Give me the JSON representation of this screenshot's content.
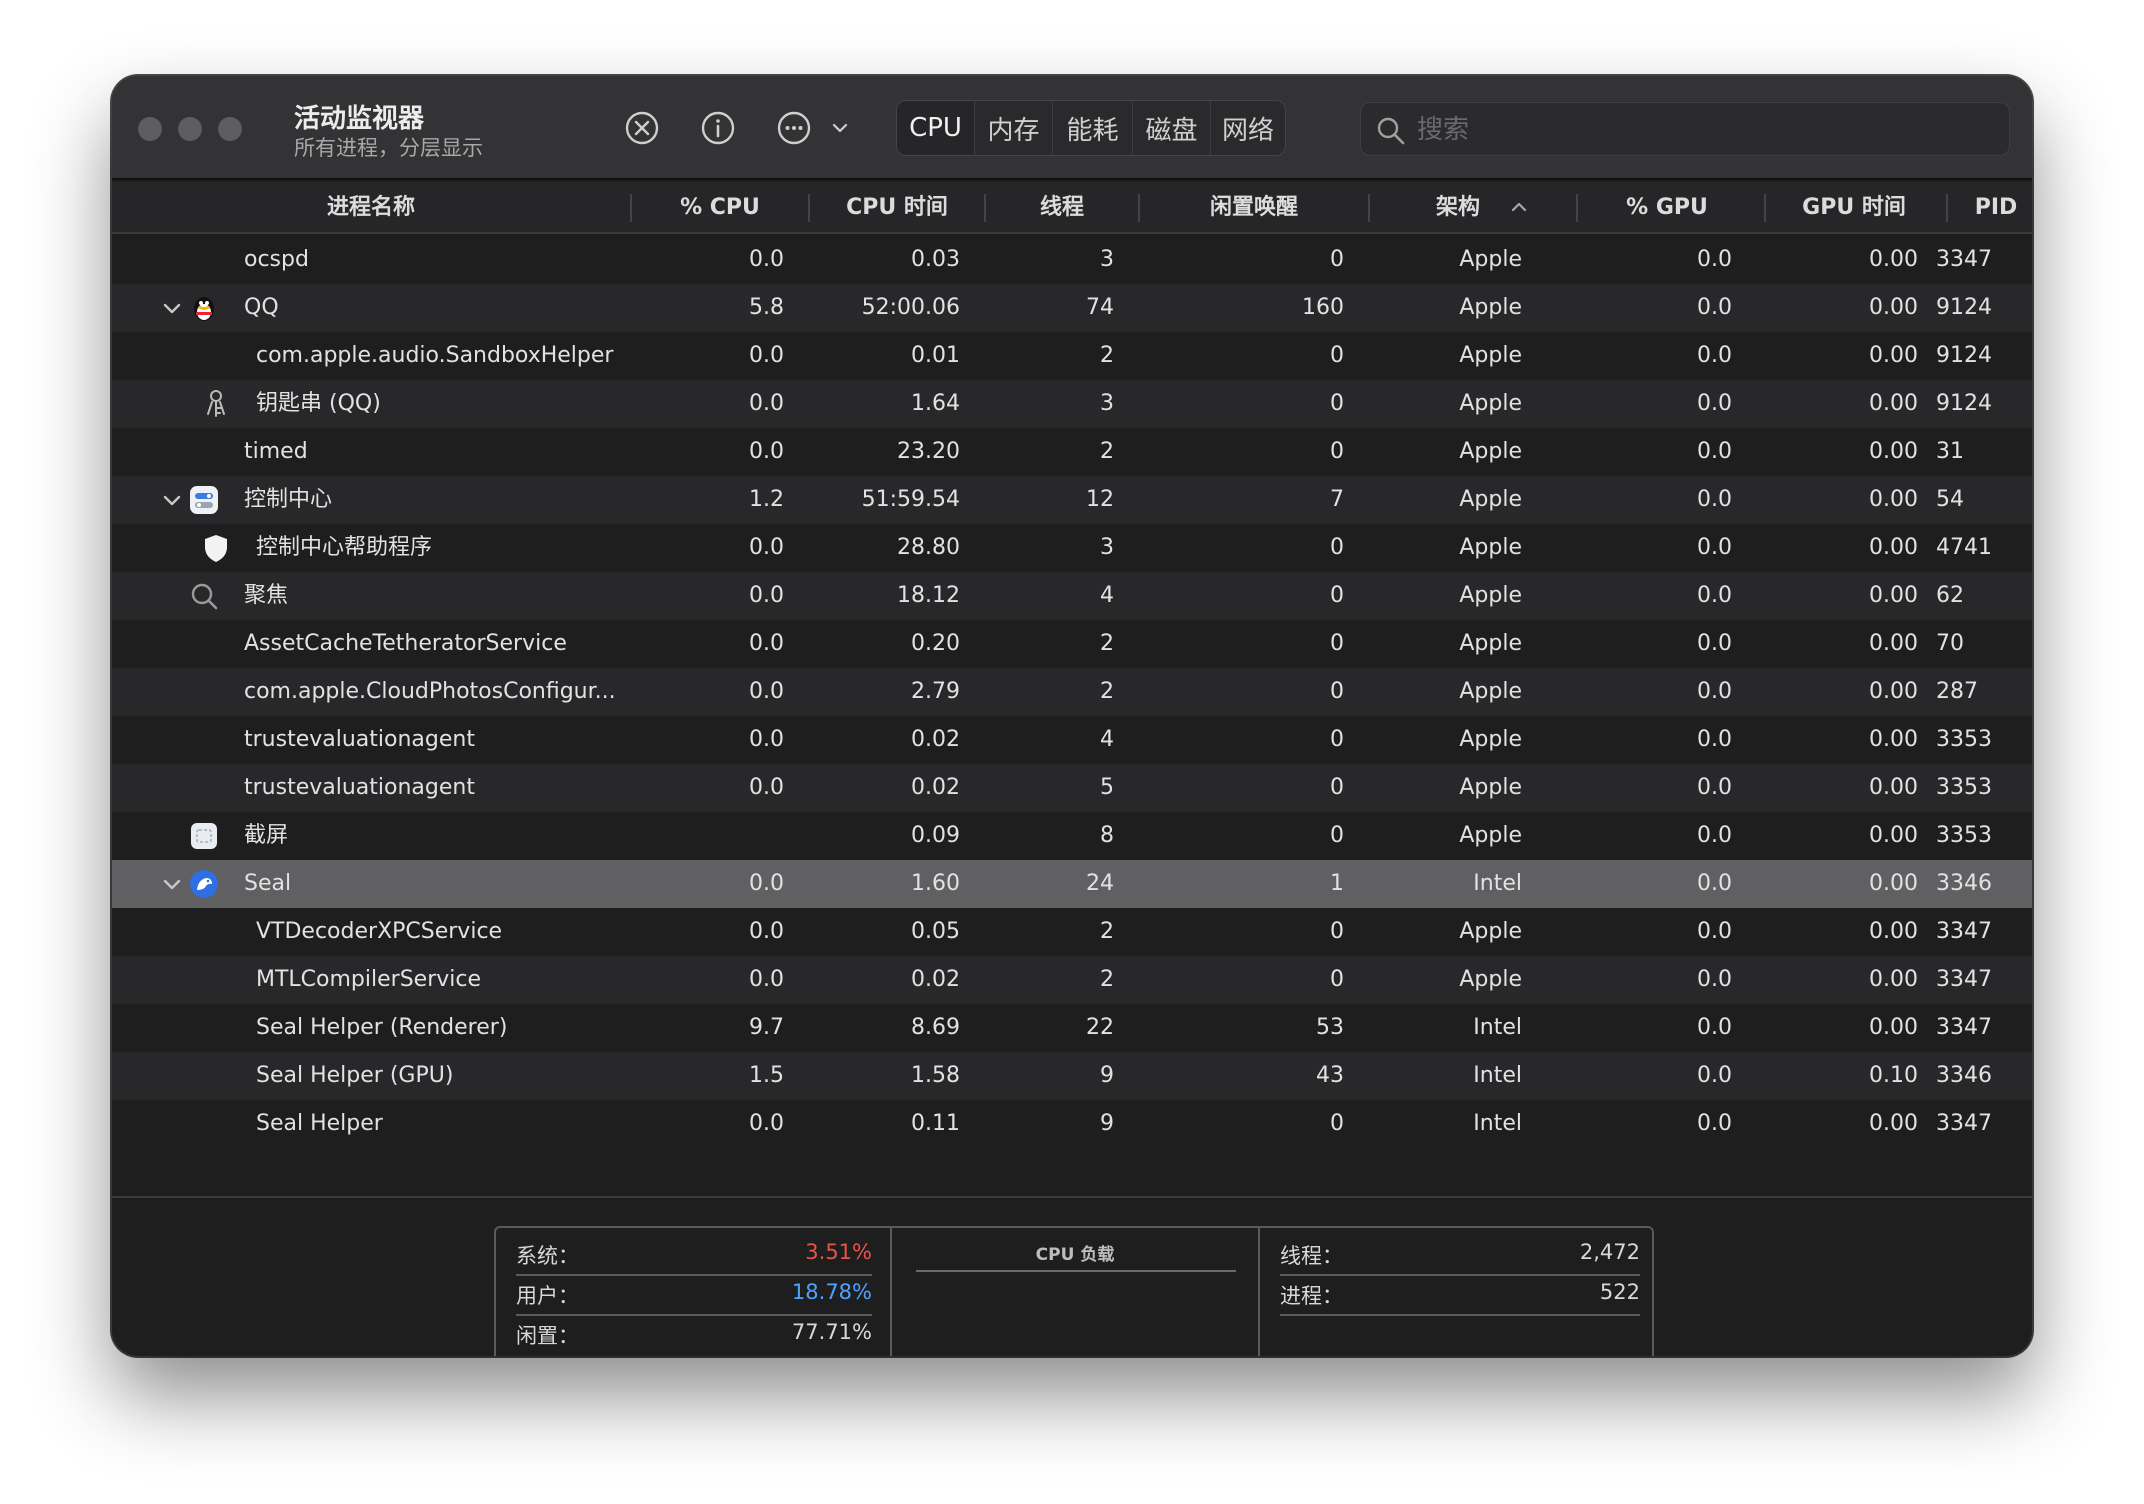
{
  "window": {
    "title": "活动监视器",
    "subtitle": "所有进程，分层显示"
  },
  "toolbar": {
    "stop_icon": "xmark-circle-icon",
    "info_icon": "info-circle-icon",
    "more_icon": "ellipsis-circle-icon",
    "tabs": [
      {
        "label": "CPU",
        "active": true
      },
      {
        "label": "内存",
        "active": false
      },
      {
        "label": "能耗",
        "active": false
      },
      {
        "label": "磁盘",
        "active": false
      },
      {
        "label": "网络",
        "active": false
      }
    ],
    "search_placeholder": "搜索"
  },
  "columns": [
    "进程名称",
    "% CPU",
    "CPU 时间",
    "线程",
    "闲置唤醒",
    "架构",
    "% GPU",
    "GPU 时间",
    "PID"
  ],
  "sort": {
    "column": "架构",
    "direction": "ascending"
  },
  "rows": [
    {
      "name": "ocspd",
      "cpu": "0.0",
      "cpu_time": "0.03",
      "threads": "3",
      "idle": "0",
      "arch": "Apple",
      "gpu": "0.0",
      "gpu_time": "0.00",
      "pid": "3347"
    },
    {
      "name": "QQ",
      "cpu": "5.8",
      "cpu_time": "52:00.06",
      "threads": "74",
      "idle": "160",
      "arch": "Apple",
      "gpu": "0.0",
      "gpu_time": "0.00",
      "pid": "9124",
      "expanded": true,
      "icon": "qq-penguin-icon"
    },
    {
      "name": "com.apple.audio.SandboxHelper",
      "cpu": "0.0",
      "cpu_time": "0.01",
      "threads": "2",
      "idle": "0",
      "arch": "Apple",
      "gpu": "0.0",
      "gpu_time": "0.00",
      "pid": "9124",
      "child": true
    },
    {
      "name": "钥匙串 (QQ)",
      "cpu": "0.0",
      "cpu_time": "1.64",
      "threads": "3",
      "idle": "0",
      "arch": "Apple",
      "gpu": "0.0",
      "gpu_time": "0.00",
      "pid": "9124",
      "child": true,
      "icon": "keychain-icon"
    },
    {
      "name": "timed",
      "cpu": "0.0",
      "cpu_time": "23.20",
      "threads": "2",
      "idle": "0",
      "arch": "Apple",
      "gpu": "0.0",
      "gpu_time": "0.00",
      "pid": "31"
    },
    {
      "name": "控制中心",
      "cpu": "1.2",
      "cpu_time": "51:59.54",
      "threads": "12",
      "idle": "7",
      "arch": "Apple",
      "gpu": "0.0",
      "gpu_time": "0.00",
      "pid": "54",
      "expanded": true,
      "icon": "control-center-icon"
    },
    {
      "name": "控制中心帮助程序",
      "cpu": "0.0",
      "cpu_time": "28.80",
      "threads": "3",
      "idle": "0",
      "arch": "Apple",
      "gpu": "0.0",
      "gpu_time": "0.00",
      "pid": "4741",
      "child": true,
      "icon": "shield-icon"
    },
    {
      "name": "聚焦",
      "cpu": "0.0",
      "cpu_time": "18.12",
      "threads": "4",
      "idle": "0",
      "arch": "Apple",
      "gpu": "0.0",
      "gpu_time": "0.00",
      "pid": "62",
      "icon": "spotlight-icon"
    },
    {
      "name": "AssetCacheTetheratorService",
      "cpu": "0.0",
      "cpu_time": "0.20",
      "threads": "2",
      "idle": "0",
      "arch": "Apple",
      "gpu": "0.0",
      "gpu_time": "0.00",
      "pid": "70"
    },
    {
      "name": "com.apple.CloudPhotosConfigur...",
      "cpu": "0.0",
      "cpu_time": "2.79",
      "threads": "2",
      "idle": "0",
      "arch": "Apple",
      "gpu": "0.0",
      "gpu_time": "0.00",
      "pid": "287"
    },
    {
      "name": "trustevaluationagent",
      "cpu": "0.0",
      "cpu_time": "0.02",
      "threads": "4",
      "idle": "0",
      "arch": "Apple",
      "gpu": "0.0",
      "gpu_time": "0.00",
      "pid": "3353"
    },
    {
      "name": "trustevaluationagent",
      "cpu": "0.0",
      "cpu_time": "0.02",
      "threads": "5",
      "idle": "0",
      "arch": "Apple",
      "gpu": "0.0",
      "gpu_time": "0.00",
      "pid": "3353"
    },
    {
      "name": "截屏",
      "cpu": "",
      "cpu_time": "0.09",
      "threads": "8",
      "idle": "0",
      "arch": "Apple",
      "gpu": "0.0",
      "gpu_time": "0.00",
      "pid": "3353",
      "icon": "screenshot-icon"
    },
    {
      "name": "Seal",
      "cpu": "0.0",
      "cpu_time": "1.60",
      "threads": "24",
      "idle": "1",
      "arch": "Intel",
      "gpu": "0.0",
      "gpu_time": "0.00",
      "pid": "3346",
      "expanded": true,
      "selected": true,
      "icon": "seal-app-icon"
    },
    {
      "name": "VTDecoderXPCService",
      "cpu": "0.0",
      "cpu_time": "0.05",
      "threads": "2",
      "idle": "0",
      "arch": "Apple",
      "gpu": "0.0",
      "gpu_time": "0.00",
      "pid": "3347",
      "child": true
    },
    {
      "name": "MTLCompilerService",
      "cpu": "0.0",
      "cpu_time": "0.02",
      "threads": "2",
      "idle": "0",
      "arch": "Apple",
      "gpu": "0.0",
      "gpu_time": "0.00",
      "pid": "3347",
      "child": true
    },
    {
      "name": "Seal Helper (Renderer)",
      "cpu": "9.7",
      "cpu_time": "8.69",
      "threads": "22",
      "idle": "53",
      "arch": "Intel",
      "gpu": "0.0",
      "gpu_time": "0.00",
      "pid": "3347",
      "child": true
    },
    {
      "name": "Seal Helper (GPU)",
      "cpu": "1.5",
      "cpu_time": "1.58",
      "threads": "9",
      "idle": "43",
      "arch": "Intel",
      "gpu": "0.0",
      "gpu_time": "0.10",
      "pid": "3346",
      "child": true
    },
    {
      "name": "Seal Helper",
      "cpu": "0.0",
      "cpu_time": "0.11",
      "threads": "9",
      "idle": "0",
      "arch": "Intel",
      "gpu": "0.0",
      "gpu_time": "0.00",
      "pid": "3347",
      "child": true
    }
  ],
  "footer": {
    "system_label": "系统：",
    "system_value": "3.51%",
    "user_label": "用户：",
    "user_value": "18.78%",
    "idle_label": "闲置：",
    "idle_value": "77.71%",
    "graph_title": "CPU 负载",
    "threads_label": "线程：",
    "threads_value": "2,472",
    "processes_label": "进程：",
    "processes_value": "522"
  },
  "colors": {
    "system": "#e8544a",
    "user": "#4da3ff",
    "window_bg": "#1e1e1e",
    "selected_row": "#606063"
  }
}
